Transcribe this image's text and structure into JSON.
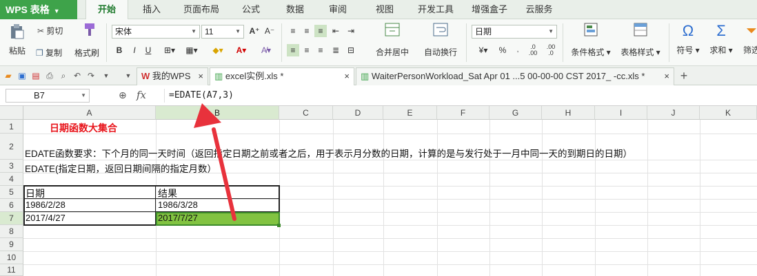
{
  "app": {
    "name": "WPS 表格"
  },
  "tabs": [
    "开始",
    "插入",
    "页面布局",
    "公式",
    "数据",
    "审阅",
    "视图",
    "开发工具",
    "增强盒子",
    "云服务"
  ],
  "ribbon": {
    "paste": "粘贴",
    "cut": "剪切",
    "copy": "复制",
    "format_painter": "格式刷",
    "font_name": "宋体",
    "font_size": "11",
    "merge_center": "合并居中",
    "wrap_text": "自动换行",
    "number_format": "日期",
    "cond_format": "条件格式",
    "table_style": "表格样式",
    "symbol": "符号",
    "sum": "求和",
    "filter": "筛选"
  },
  "doc_tabs": [
    "我的WPS",
    "excel实例.xls *",
    "WaiterPersonWorkload_Sat Apr 01 ...5 00-00-00 CST 2017_  -cc.xls *"
  ],
  "formula_bar": {
    "name_box": "B7",
    "fx": "fx",
    "formula": "=EDATE(A7,3)"
  },
  "columns": [
    "A",
    "B",
    "C",
    "D",
    "E",
    "F",
    "G",
    "H",
    "I",
    "J",
    "K"
  ],
  "rows": [
    "1",
    "2",
    "3",
    "4",
    "5",
    "6",
    "7",
    "8",
    "9",
    "10",
    "11"
  ],
  "sheet": {
    "title": "日期函数大集合",
    "desc1": "EDATE函数要求：下个月的同一天时间（返回指定日期之前或者之后，用于表示月分数的日期，计算的是与发行处于一月中同一天的到期日的日期）",
    "desc2": "EDATE(指定日期，返回日期间隔的指定月数）",
    "header_a": "日期",
    "header_b": "结果",
    "a6": "1986/2/28",
    "b6": "1986/3/28",
    "a7": "2017/4/27",
    "b7": "2017/7/27"
  },
  "colors": {
    "accent_green": "#3ea34a",
    "selected_cell": "#82c341",
    "title_red": "#e8141b",
    "arrow_red": "#e8323c"
  }
}
